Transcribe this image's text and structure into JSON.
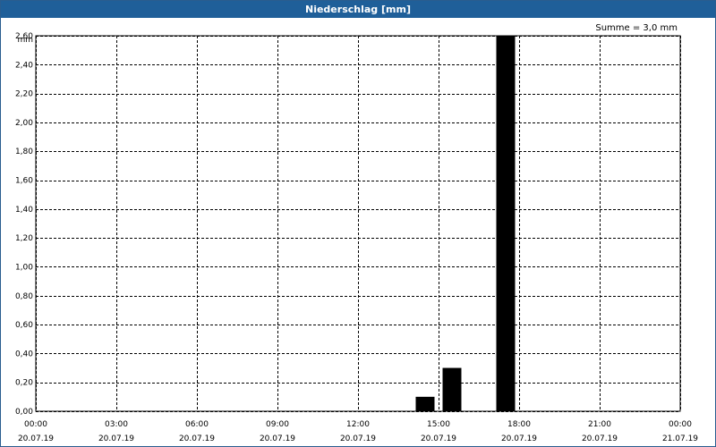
{
  "window": {
    "title": "Niederschlag [mm]"
  },
  "chart_data": {
    "type": "bar",
    "title": "Niederschlag [mm]",
    "annotation": "Summe = 3,0 mm",
    "ylabel": "mm",
    "xlabel": "",
    "ylim": [
      0,
      2.6
    ],
    "yticks": [
      0,
      0.2,
      0.4,
      0.6,
      0.8,
      1.0,
      1.2,
      1.4,
      1.6,
      1.8,
      2.0,
      2.2,
      2.4,
      2.6
    ],
    "ytick_labels": [
      "0,00",
      "0,20",
      "0,40",
      "0,60",
      "0,80",
      "1,00",
      "1,20",
      "1,40",
      "1,60",
      "1,80",
      "2,00",
      "2,20",
      "2,40",
      "2,60"
    ],
    "xlim_hours": [
      0,
      24
    ],
    "xticks_hours": [
      0,
      3,
      6,
      9,
      12,
      15,
      18,
      21,
      24
    ],
    "xtick_times": [
      "00:00",
      "03:00",
      "06:00",
      "09:00",
      "12:00",
      "15:00",
      "18:00",
      "21:00",
      "00:00"
    ],
    "xtick_dates": [
      "20.07.19",
      "20.07.19",
      "20.07.19",
      "20.07.19",
      "20.07.19",
      "20.07.19",
      "20.07.19",
      "20.07.19",
      "21.07.19"
    ],
    "bar_hours": [
      15,
      16,
      18
    ],
    "values": [
      0.1,
      0.3,
      2.6
    ],
    "grid": true,
    "bar_color": "#000000"
  }
}
